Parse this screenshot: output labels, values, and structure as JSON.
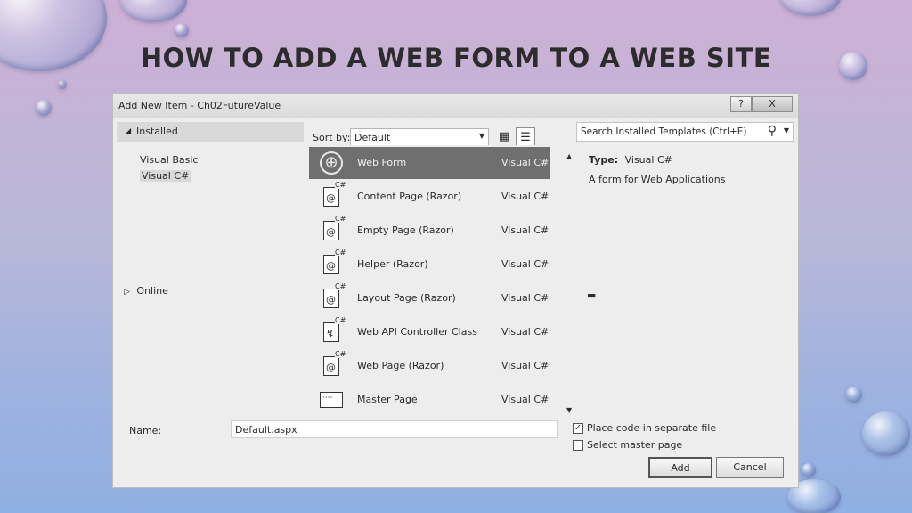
{
  "slide": {
    "title": "HOW TO ADD A WEB FORM TO A WEB SITE"
  },
  "dialog": {
    "title": "Add New Item - Ch02FutureValue",
    "help_label": "?",
    "close_label": "X",
    "left_pane": {
      "installed_label": "Installed",
      "languages": [
        "Visual Basic",
        "Visual C#"
      ],
      "selected_language": "Visual C#",
      "online_label": "Online"
    },
    "toolbar": {
      "sort_label": "Sort by:",
      "sort_value": "Default"
    },
    "search": {
      "placeholder": "Search Installed Templates (Ctrl+E)"
    },
    "templates": [
      {
        "name": "Web Form",
        "language": "Visual C#",
        "icon": "globe-icon",
        "selected": true
      },
      {
        "name": "Content Page (Razor)",
        "language": "Visual C#",
        "icon": "razor-page-icon"
      },
      {
        "name": "Empty Page (Razor)",
        "language": "Visual C#",
        "icon": "razor-page-icon"
      },
      {
        "name": "Helper (Razor)",
        "language": "Visual C#",
        "icon": "razor-page-icon"
      },
      {
        "name": "Layout Page (Razor)",
        "language": "Visual C#",
        "icon": "razor-page-icon"
      },
      {
        "name": "Web API Controller Class",
        "language": "Visual C#",
        "icon": "controller-class-icon"
      },
      {
        "name": "Web Page (Razor)",
        "language": "Visual C#",
        "icon": "razor-page-icon"
      },
      {
        "name": "Master Page",
        "language": "Visual C#",
        "icon": "master-page-icon"
      }
    ],
    "details": {
      "type_label": "Type:",
      "type_value": "Visual C#",
      "description": "A form for Web Applications"
    },
    "name_label": "Name:",
    "name_value": "Default.aspx",
    "options": {
      "place_code_label": "Place code in separate file",
      "place_code_checked": true,
      "select_master_label": "Select master page",
      "select_master_checked": false
    },
    "buttons": {
      "add": "Add",
      "cancel": "Cancel"
    }
  }
}
